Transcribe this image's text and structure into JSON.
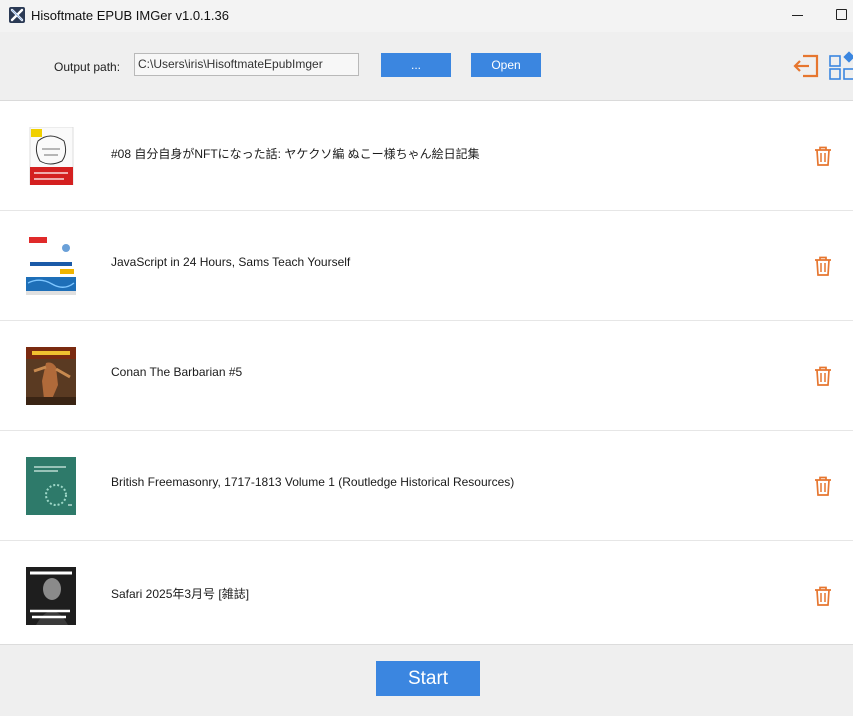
{
  "window": {
    "title": "Hisoftmate EPUB IMGer v1.0.1.36"
  },
  "toolbar": {
    "output_label": "Output path:",
    "output_path": "C:\\Users\\iris\\HisoftmateEpubImger",
    "browse_label": "...",
    "open_label": "Open",
    "icons": [
      "exit-icon",
      "grid-layout-icon"
    ],
    "accent_color": "#3b86e0",
    "icon_color": "#e6762f"
  },
  "books": [
    {
      "title": "#08 自分自身がNFTになった話: ヤケクソ編 ぬこー様ちゃん絵日記集"
    },
    {
      "title": "JavaScript in 24 Hours, Sams Teach Yourself"
    },
    {
      "title": "Conan The Barbarian #5"
    },
    {
      "title": "British Freemasonry, 1717-1813 Volume 1 (Routledge Historical Resources)"
    },
    {
      "title": "Safari 2025年3月号 [雑誌]"
    }
  ],
  "footer": {
    "start_label": "Start"
  }
}
